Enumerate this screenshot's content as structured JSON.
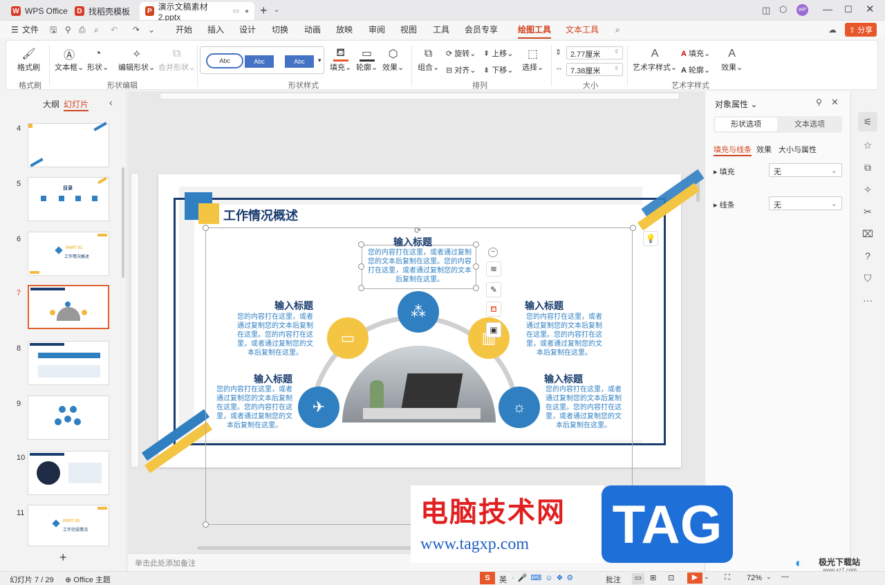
{
  "titlebar": {
    "tabs": [
      {
        "label": "WPS Office",
        "icon": "W"
      },
      {
        "label": "找稻壳模板",
        "icon": "D"
      },
      {
        "label": "演示文稿素材2.pptx",
        "icon": "P"
      }
    ],
    "new_tab": "+",
    "avatar": "WP"
  },
  "menubar": {
    "file": "文件",
    "items": [
      "开始",
      "插入",
      "设计",
      "切换",
      "动画",
      "放映",
      "审阅",
      "视图",
      "工具",
      "会员专享"
    ],
    "drawing_tools": "绘图工具",
    "text_tools": "文本工具",
    "share": "分享"
  },
  "ribbon": {
    "format_painter": "格式刷",
    "textbox": "文本框",
    "shape": "形状",
    "edit_shape": "编辑形状",
    "merge_shape": "合并形状",
    "style_sample": "Abc",
    "fill": "填充",
    "outline": "轮廓",
    "effect": "效果",
    "combine": "组合",
    "rotate": "旋转",
    "align": "对齐",
    "move_up": "上移",
    "move_down": "下移",
    "select": "选择",
    "height_value": "2.77厘米",
    "width_value": "7.38厘米",
    "art_text_style": "艺术字样式",
    "art_fill": "填充",
    "art_outline": "轮廓",
    "art_effect": "效果",
    "groups": [
      "格式刷",
      "形状编辑",
      "形状样式",
      "排列",
      "大小",
      "艺术字样式"
    ]
  },
  "leftpanel": {
    "tab_outline": "大纲",
    "tab_slides": "幻灯片",
    "slide_numbers": [
      "4",
      "5",
      "6",
      "7",
      "8",
      "9",
      "10",
      "11"
    ],
    "thumb5_title": "目录",
    "thumb6_part": "PART 01",
    "thumb6_title": "工作情况概述",
    "thumb11_part": "PART 02",
    "thumb11_title": "工作完成情况",
    "add": "+"
  },
  "slide": {
    "title": "工作情况概述",
    "heading": "输入标题",
    "top_body": "您的内容打在这里，或者通过复制您的文本后复制在这里。您的内容打在这里，或者通过复制您的文本后复制在这里。",
    "side_body": "您的内容打在这里，或者通过复制您的文本后复制在这里。您的内容打在这里，或者通过复制您的文本后复制在这里。"
  },
  "notes_placeholder": "单击此处添加备注",
  "rightpanel": {
    "title": "对象属性",
    "tab_shape": "形状选项",
    "tab_text": "文本选项",
    "sub_fill_line": "填充与线条",
    "sub_effect": "效果",
    "sub_size": "大小与属性",
    "fill_label": "填充",
    "fill_value": "无",
    "line_label": "线条",
    "line_value": "无"
  },
  "statusbar": {
    "slide_info": "幻灯片 7 / 29",
    "theme": "Office 主题",
    "ime": "英",
    "notes": "批注",
    "zoom": "72%"
  },
  "watermark": {
    "site_cn": "电脑技术网",
    "site_url": "www.tagxp.com",
    "tag": "TAG",
    "corner": "极光下载站",
    "corner_url": "www.xz7.com"
  }
}
